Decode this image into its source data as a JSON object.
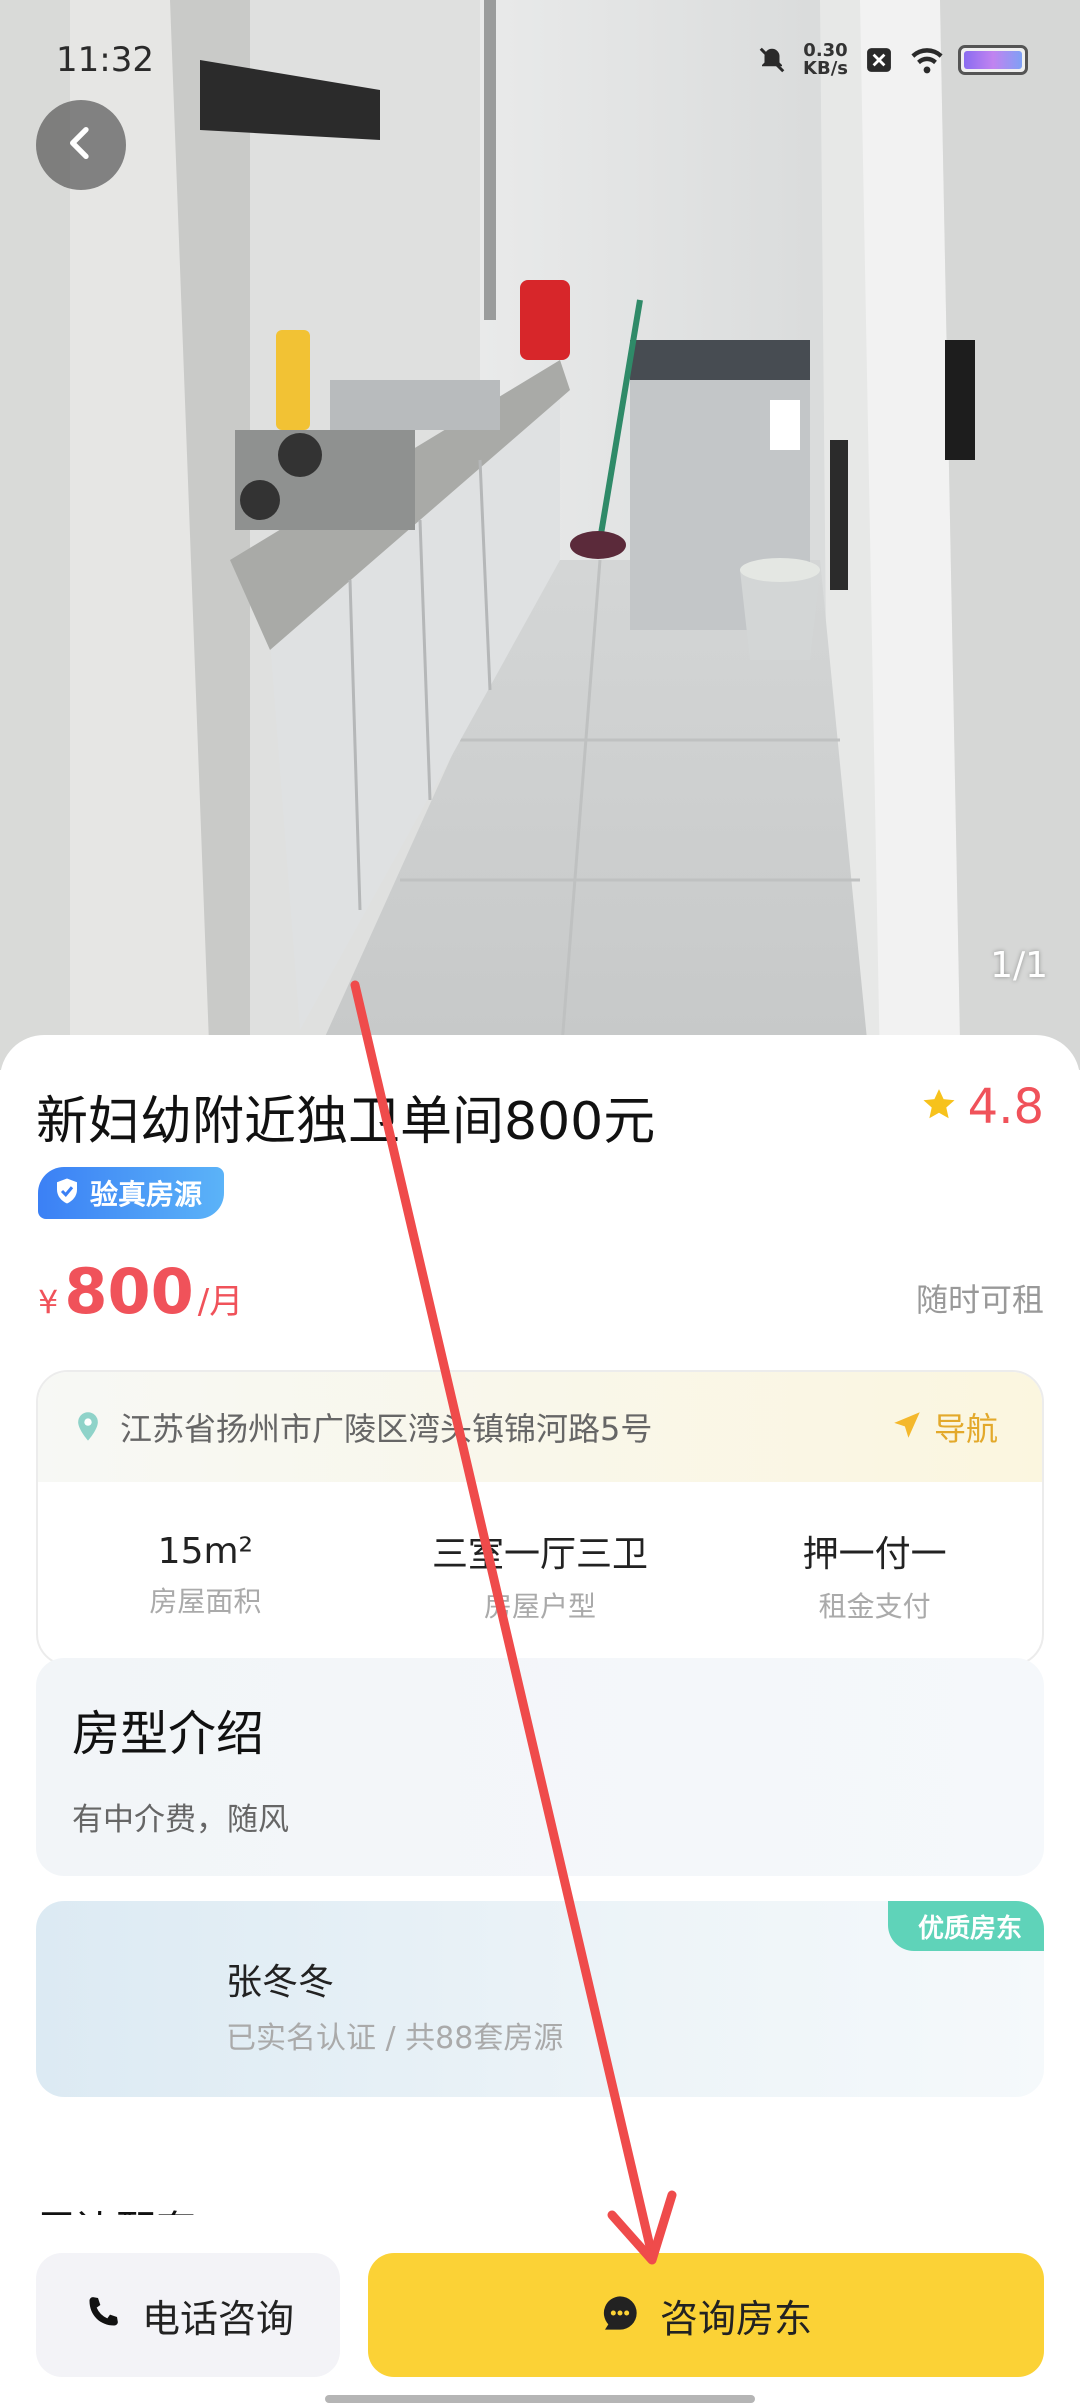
{
  "status_bar": {
    "time": "11:32",
    "speed_value": "0.30",
    "speed_unit": "KB/s"
  },
  "gallery": {
    "counter": "1/1"
  },
  "listing": {
    "title": "新妇幼附近独卫单间800元",
    "rating": "4.8",
    "verified_label": "验真房源",
    "price_currency": "¥",
    "price_value": "800",
    "price_unit": "/月",
    "availability": "随时可租"
  },
  "location": {
    "address": "江苏省扬州市广陵区湾头镇锦河路5号",
    "nav_label": "导航"
  },
  "stats": [
    {
      "value": "15m²",
      "label": "房屋面积"
    },
    {
      "value": "三室一厅三卫",
      "label": "房屋户型"
    },
    {
      "value": "押一付一",
      "label": "租金支付"
    }
  ],
  "intro": {
    "title": "房型介绍",
    "text": "有中介费，随风"
  },
  "landlord": {
    "name": "张冬冬",
    "desc": "已实名认证 / 共88套房源",
    "badge": "优质房东"
  },
  "nearby": {
    "title": "周边配套"
  },
  "actions": {
    "call_label": "电话咨询",
    "consult_label": "咨询房东"
  },
  "colors": {
    "accent_red": "#f0525a",
    "primary_yellow": "#fbd236",
    "badge_blue": "#3b80f5",
    "badge_green": "#5fd3b9",
    "annotation_arrow": "#ef4b4b"
  },
  "icons": {
    "back": "chevron-left-icon",
    "star": "star-icon",
    "verified": "shield-check-icon",
    "location": "location-pin-icon",
    "navigation": "navigation-arrow-icon",
    "phone": "phone-icon",
    "chat": "chat-bubble-icon"
  }
}
